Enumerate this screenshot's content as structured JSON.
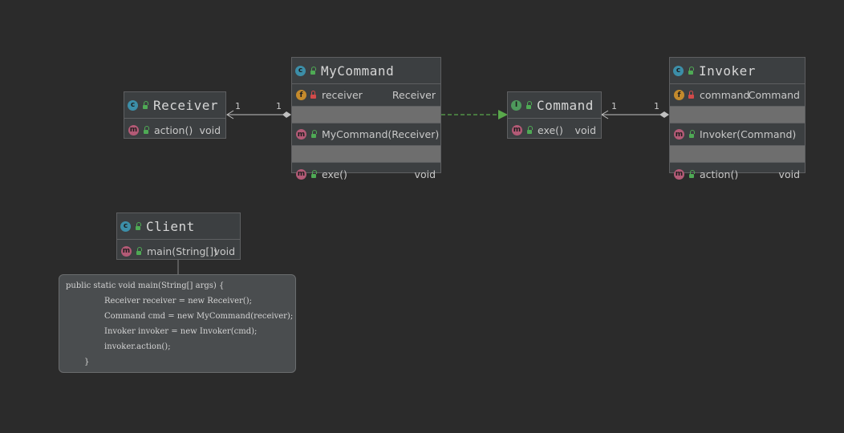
{
  "classes": {
    "receiver": {
      "name": "Receiver",
      "kind_badge": "c",
      "methods": [
        {
          "name": "action()",
          "type": "void"
        }
      ]
    },
    "mycommand": {
      "name": "MyCommand",
      "kind_badge": "c",
      "fields": [
        {
          "name": "receiver",
          "type": "Receiver"
        }
      ],
      "constructors": [
        {
          "name": "MyCommand(Receiver)"
        }
      ],
      "methods": [
        {
          "name": "exe()",
          "type": "void"
        }
      ]
    },
    "command": {
      "name": "Command",
      "kind_badge": "I",
      "methods": [
        {
          "name": "exe()",
          "type": "void"
        }
      ]
    },
    "invoker": {
      "name": "Invoker",
      "kind_badge": "c",
      "fields": [
        {
          "name": "command",
          "type": "Command"
        }
      ],
      "constructors": [
        {
          "name": "Invoker(Command)"
        }
      ],
      "methods": [
        {
          "name": "action()",
          "type": "void"
        }
      ]
    },
    "client": {
      "name": "Client",
      "kind_badge": "c",
      "methods": [
        {
          "name": "main(String[])",
          "type": "void"
        }
      ]
    }
  },
  "badges": {
    "field": "f",
    "method": "m"
  },
  "multiplicities": {
    "mycommand_receiver": {
      "source": "1",
      "target": "1"
    },
    "invoker_command": {
      "source": "1",
      "target": "1"
    }
  },
  "note": {
    "lines": [
      "public static void main(String[] args) {",
      "Receiver receiver = new Receiver();",
      "Command cmd = new MyCommand(receiver);",
      "Invoker invoker = new Invoker(cmd);",
      "invoker.action();",
      "}"
    ]
  },
  "colors": {
    "background": "#2b2b2b",
    "class_box": "#3c3f41",
    "realization_arrow": "#59a84b",
    "association_line": "#c0c0c0",
    "class_badge": "#3c8ea8",
    "interface_badge": "#4e9a5c",
    "method_badge": "#b35a76",
    "field_badge": "#c48a2c"
  }
}
